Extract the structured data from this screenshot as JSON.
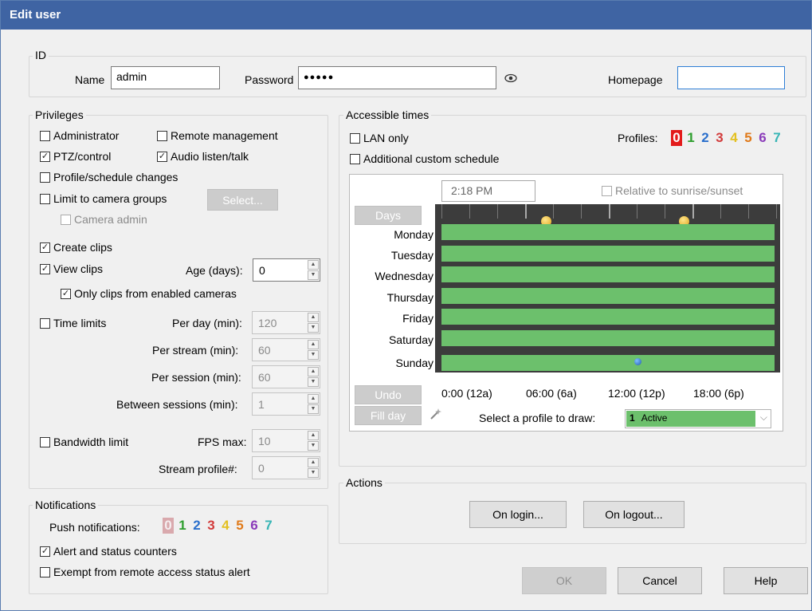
{
  "window": {
    "title": "Edit user"
  },
  "id": {
    "group_title": "ID",
    "name_label": "Name",
    "name_value": "admin",
    "password_label": "Password",
    "password_value": "●●●●●",
    "eye_icon": "eye-icon",
    "homepage_label": "Homepage",
    "homepage_value": ""
  },
  "privileges": {
    "group_title": "Privileges",
    "administrator": "Administrator",
    "remote_management": "Remote management",
    "ptz_control": "PTZ/control",
    "audio": "Audio listen/talk",
    "profile_changes": "Profile/schedule changes",
    "limit_groups": "Limit to camera groups",
    "select_button": "Select...",
    "camera_admin": "Camera admin",
    "create_clips": "Create clips",
    "view_clips": "View clips",
    "age_label": "Age (days):",
    "age_value": "0",
    "only_enabled": "Only clips from enabled cameras",
    "time_limits": "Time limits",
    "per_day_label": "Per day (min):",
    "per_day_value": "120",
    "per_stream_label": "Per stream (min):",
    "per_stream_value": "60",
    "per_session_label": "Per session (min):",
    "per_session_value": "60",
    "between_label": "Between sessions (min):",
    "between_value": "1",
    "bandwidth_limit": "Bandwidth limit",
    "fps_label": "FPS max:",
    "fps_value": "10",
    "stream_profile_label": "Stream profile#:",
    "stream_profile_value": "0"
  },
  "notifications": {
    "group_title": "Notifications",
    "push_label": "Push notifications:",
    "push_profiles": [
      "0",
      "1",
      "2",
      "3",
      "4",
      "5",
      "6",
      "7"
    ],
    "alert_counters": "Alert and status counters",
    "exempt": "Exempt from remote access status alert"
  },
  "accessible": {
    "group_title": "Accessible times",
    "lan_only": "LAN only",
    "custom_schedule": "Additional custom schedule",
    "profiles_label": "Profiles:",
    "profiles": [
      "0",
      "1",
      "2",
      "3",
      "4",
      "5",
      "6",
      "7"
    ],
    "profile_colors": [
      "#ffffff",
      "#2e9e2e",
      "#2a6fcc",
      "#d23b3b",
      "#e3c020",
      "#e07a1a",
      "#8a3ab9",
      "#37b5b5"
    ],
    "time_value": "2:18 PM",
    "relative_sun": "Relative to sunrise/sunset",
    "days_button": "Days",
    "days": [
      "Monday",
      "Tuesday",
      "Wednesday",
      "Thursday",
      "Friday",
      "Saturday",
      "Sunday"
    ],
    "hours": [
      "0:00 (12a)",
      "06:00 (6a)",
      "12:00 (12p)",
      "18:00 (6p)"
    ],
    "undo_button": "Undo",
    "fill_day_button": "Fill day",
    "wand_icon": "magic-wand-icon",
    "select_profile_label": "Select a profile to draw:",
    "selected_profile_number": "1",
    "selected_profile_name": "Active"
  },
  "actions": {
    "group_title": "Actions",
    "on_login": "On login...",
    "on_logout": "On logout..."
  },
  "footer": {
    "ok": "OK",
    "cancel": "Cancel",
    "help": "Help"
  }
}
